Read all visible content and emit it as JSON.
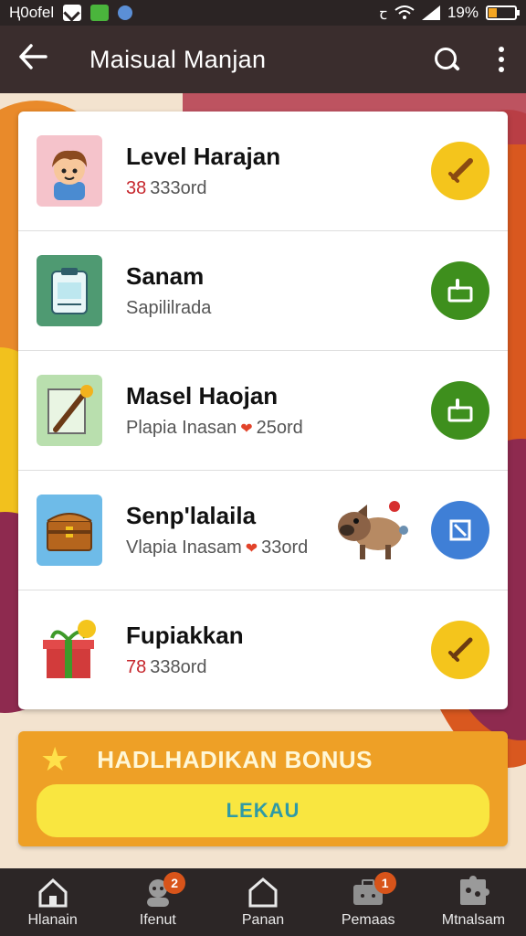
{
  "status_bar": {
    "carrier": "Ң0оfеl",
    "battery": "19%"
  },
  "app_bar": {
    "title": "Maisual Manjan",
    "back_icon": "arrow-left-icon",
    "search_icon": "search-icon",
    "more_icon": "more-vertical-icon"
  },
  "list": {
    "items": [
      {
        "name": "Level Harajan",
        "sub_num": "38",
        "sub_text": "333ord",
        "icon": "boy-avatar-icon",
        "action_icon": "sword-icon",
        "action_color": "#f4c51c"
      },
      {
        "name": "Sanam",
        "sub_num": "",
        "sub_text": "Sapililrada",
        "icon": "clipboard-icon",
        "action_icon": "thumb-up-icon",
        "action_color": "#3e8f1d"
      },
      {
        "name": "Masel Haojan",
        "sub_num": "",
        "sub_text": "Plapia Inasan",
        "sub_tail": "25ord",
        "icon": "wand-icon",
        "action_icon": "thumb-up-icon",
        "action_color": "#3e8f1d"
      },
      {
        "name": "Senp'lalaila",
        "sub_num": "",
        "sub_text": "Vlapia Inasam",
        "sub_tail": "33ord",
        "icon": "treasure-chest-icon",
        "action_icon": "expand-icon",
        "action_color": "#3f7fd6"
      },
      {
        "name": "Fupiakkan",
        "sub_num": "78",
        "sub_text": "338ord",
        "icon": "gift-box-icon",
        "action_icon": "sword-icon",
        "action_color": "#f4c51c"
      }
    ]
  },
  "bonus": {
    "label": "HADLHADIKAN BONUS",
    "button": "LEKAU"
  },
  "bottom_nav": {
    "items": [
      {
        "label": "Hlanain",
        "icon": "home-icon",
        "badge": ""
      },
      {
        "label": "Ifenut",
        "icon": "chat-bot-icon",
        "badge": "2"
      },
      {
        "label": "Panan",
        "icon": "house-outline-icon",
        "badge": ""
      },
      {
        "label": "Pemaas",
        "icon": "briefcase-icon",
        "badge": "1"
      },
      {
        "label": "Mtnalsam",
        "icon": "puzzle-icon",
        "badge": ""
      }
    ]
  }
}
